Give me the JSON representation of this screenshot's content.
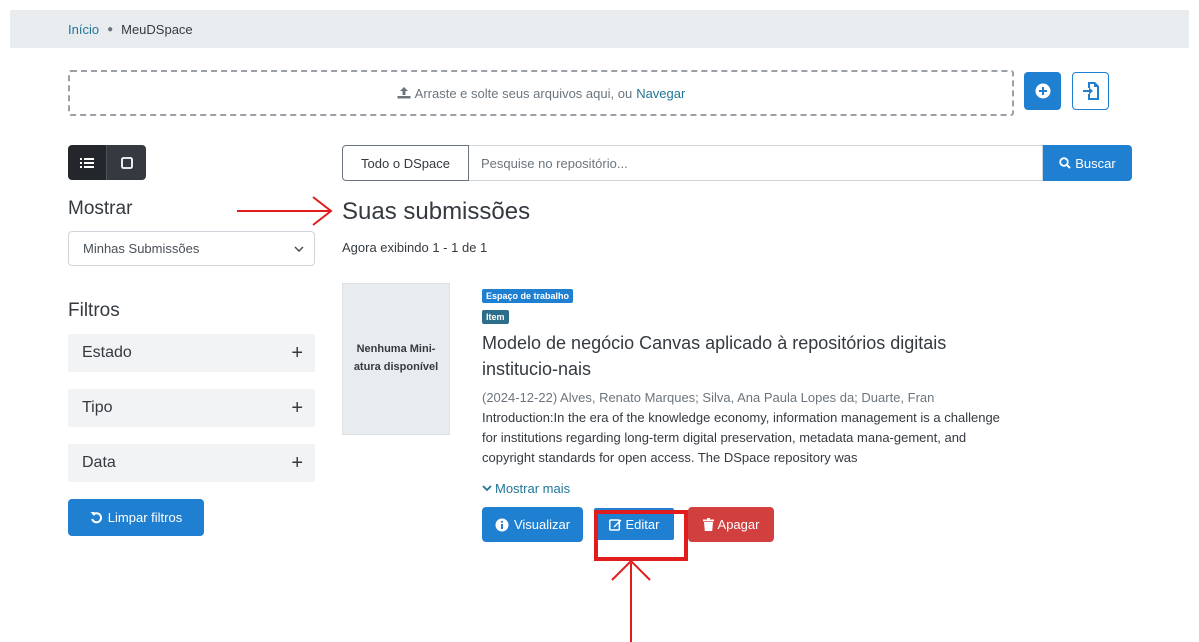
{
  "breadcrumb": {
    "home": "Início",
    "current": "MeuDSpace"
  },
  "upload": {
    "text": "Arraste e solte seus arquivos aqui, ou",
    "browse": "Navegar"
  },
  "sidebar": {
    "show_title": "Mostrar",
    "show_value": "Minhas Submissões",
    "filters_title": "Filtros",
    "filters": [
      {
        "label": "Estado"
      },
      {
        "label": "Tipo"
      },
      {
        "label": "Data"
      }
    ],
    "clear_label": "Limpar filtros"
  },
  "search": {
    "scope": "Todo o DSpace",
    "placeholder": "Pesquise no repositório...",
    "button": "Buscar"
  },
  "results": {
    "title": "Suas submissões",
    "count": "Agora exibindo 1 - 1 de 1"
  },
  "item": {
    "thumbnail_text": "Nenhuma Mini-atura disponível",
    "badge_workspace": "Espaço de trabalho",
    "badge_type": "Item",
    "title": "Modelo de negócio Canvas aplicado à repositórios digitais institucio-nais",
    "meta": "(2024-12-22) Alves, Renato Marques; Silva, Ana Paula Lopes da; Duarte, Fran",
    "abstract": "Introduction:In the era of the knowledge economy, information management is a challenge for institutions regarding long-term digital preservation, metadata mana-gement, and copyright standards for open access. The DSpace repository was",
    "show_more": "Mostrar mais",
    "view_label": "Visualizar",
    "edit_label": "Editar",
    "delete_label": "Apagar"
  },
  "colors": {
    "primary": "#1f7fd1",
    "danger": "#d1403f",
    "dark": "#343a40",
    "annotation": "#e01c1c",
    "link": "#207698"
  }
}
